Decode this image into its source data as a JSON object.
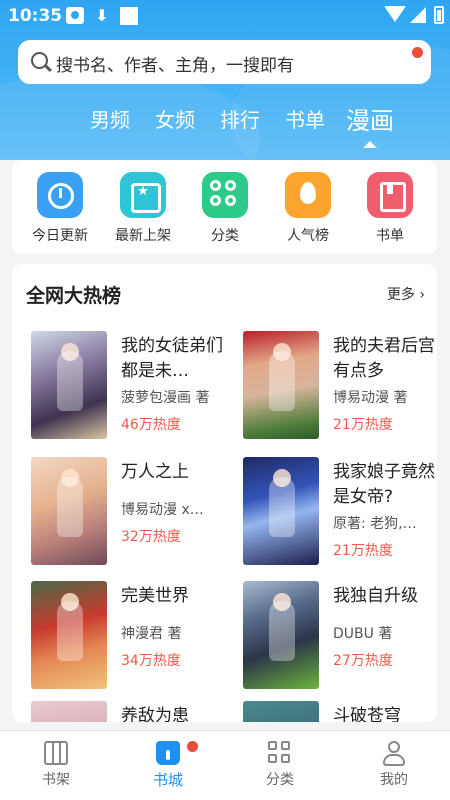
{
  "status_bar": {
    "time": "10:35"
  },
  "search": {
    "placeholder": "搜书名、作者、主角，一搜即有"
  },
  "top_tabs": [
    "男频",
    "女频",
    "排行",
    "书单",
    "漫画"
  ],
  "active_top_tab": "漫画",
  "quick_menu": [
    {
      "label": "今日更新",
      "icon": "clock-icon",
      "color": "#3aa0f3"
    },
    {
      "label": "最新上架",
      "icon": "star-box-icon",
      "color": "#30c5d6"
    },
    {
      "label": "分类",
      "icon": "category-icon",
      "color": "#2dca8a"
    },
    {
      "label": "人气榜",
      "icon": "flame-icon",
      "color": "#fba52e"
    },
    {
      "label": "书单",
      "icon": "bookmark-icon",
      "color": "#f05d6d"
    }
  ],
  "ranking": {
    "title": "全网大热榜",
    "more_label": "更多",
    "books": [
      {
        "title": "我的女徒弟们都是未…",
        "author": "菠萝包漫画 著",
        "heat": "46万热度"
      },
      {
        "title": "我的夫君后宫有点多",
        "author": "博易动漫 著",
        "heat": "21万热度"
      },
      {
        "title": "万人之上",
        "author": "博易动漫 x…",
        "heat": "32万热度"
      },
      {
        "title": "我家娘子竟然是女帝?",
        "author": "原著: 老狗,…",
        "heat": "21万热度"
      },
      {
        "title": "完美世界",
        "author": "神漫君 著",
        "heat": "34万热度"
      },
      {
        "title": "我独自升级",
        "author": "DUBU 著",
        "heat": "27万热度"
      },
      {
        "title": "养敌为患",
        "author": "",
        "heat": ""
      },
      {
        "title": "斗破苍穹",
        "author": "",
        "heat": ""
      }
    ]
  },
  "bottom_tabs": [
    {
      "label": "书架",
      "icon": "bookshelf-icon"
    },
    {
      "label": "书城",
      "icon": "bookstore-icon"
    },
    {
      "label": "分类",
      "icon": "grid-icon"
    },
    {
      "label": "我的",
      "icon": "profile-icon"
    }
  ],
  "colors": {
    "accent": "#1e90f2",
    "header": "#2fa6f3",
    "heat": "#ef5a4b",
    "badge": "#ea4b3b"
  }
}
